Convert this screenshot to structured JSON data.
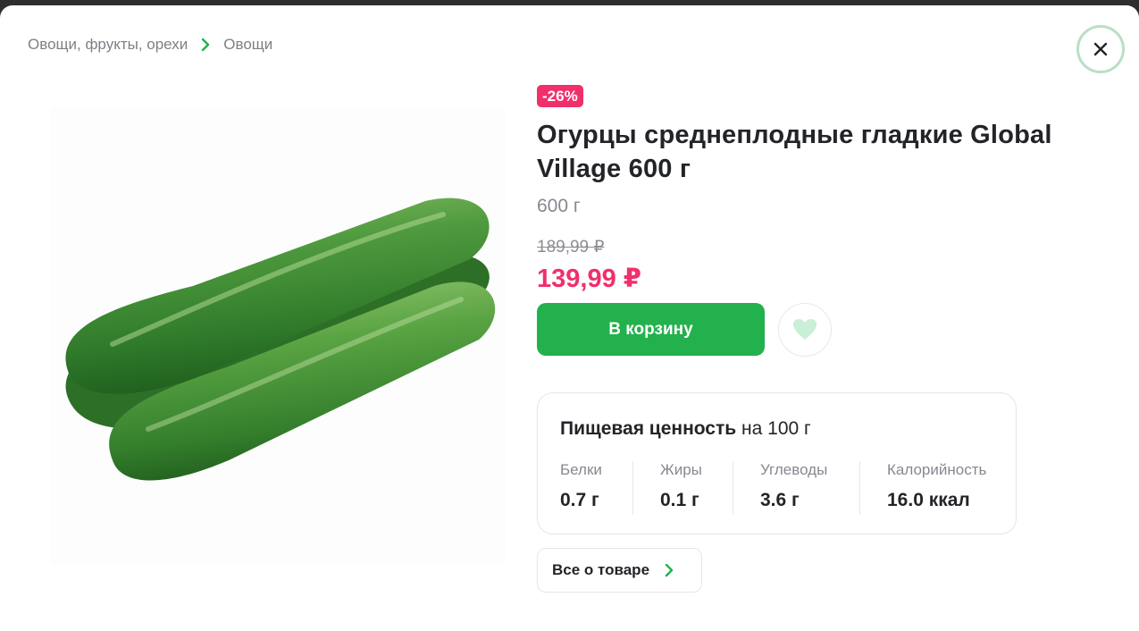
{
  "breadcrumb": {
    "items": [
      "Овощи, фрукты, орехи",
      "Овощи"
    ]
  },
  "product": {
    "discount": "-26%",
    "title": "Огурцы среднеплодные гладкие Global Village 600 г",
    "weight": "600 г",
    "old_price": "189,99 ₽",
    "new_price": "139,99 ₽",
    "cart_label": "В корзину"
  },
  "nutrition": {
    "title": "Пищевая ценность",
    "per": "на 100 г",
    "items": [
      {
        "label": "Белки",
        "value": "0.7 г"
      },
      {
        "label": "Жиры",
        "value": "0.1 г"
      },
      {
        "label": "Углеводы",
        "value": "3.6 г"
      },
      {
        "label": "Калорийность",
        "value": "16.0 ккал"
      }
    ]
  },
  "details_button": "Все о товаре",
  "icons": {
    "close": "close-icon",
    "favorite": "heart-icon",
    "chevron": "chevron-right-icon"
  },
  "colors": {
    "accent": "#22b14c",
    "sale": "#f0306b",
    "favorite_heart": "#c9efd6"
  }
}
